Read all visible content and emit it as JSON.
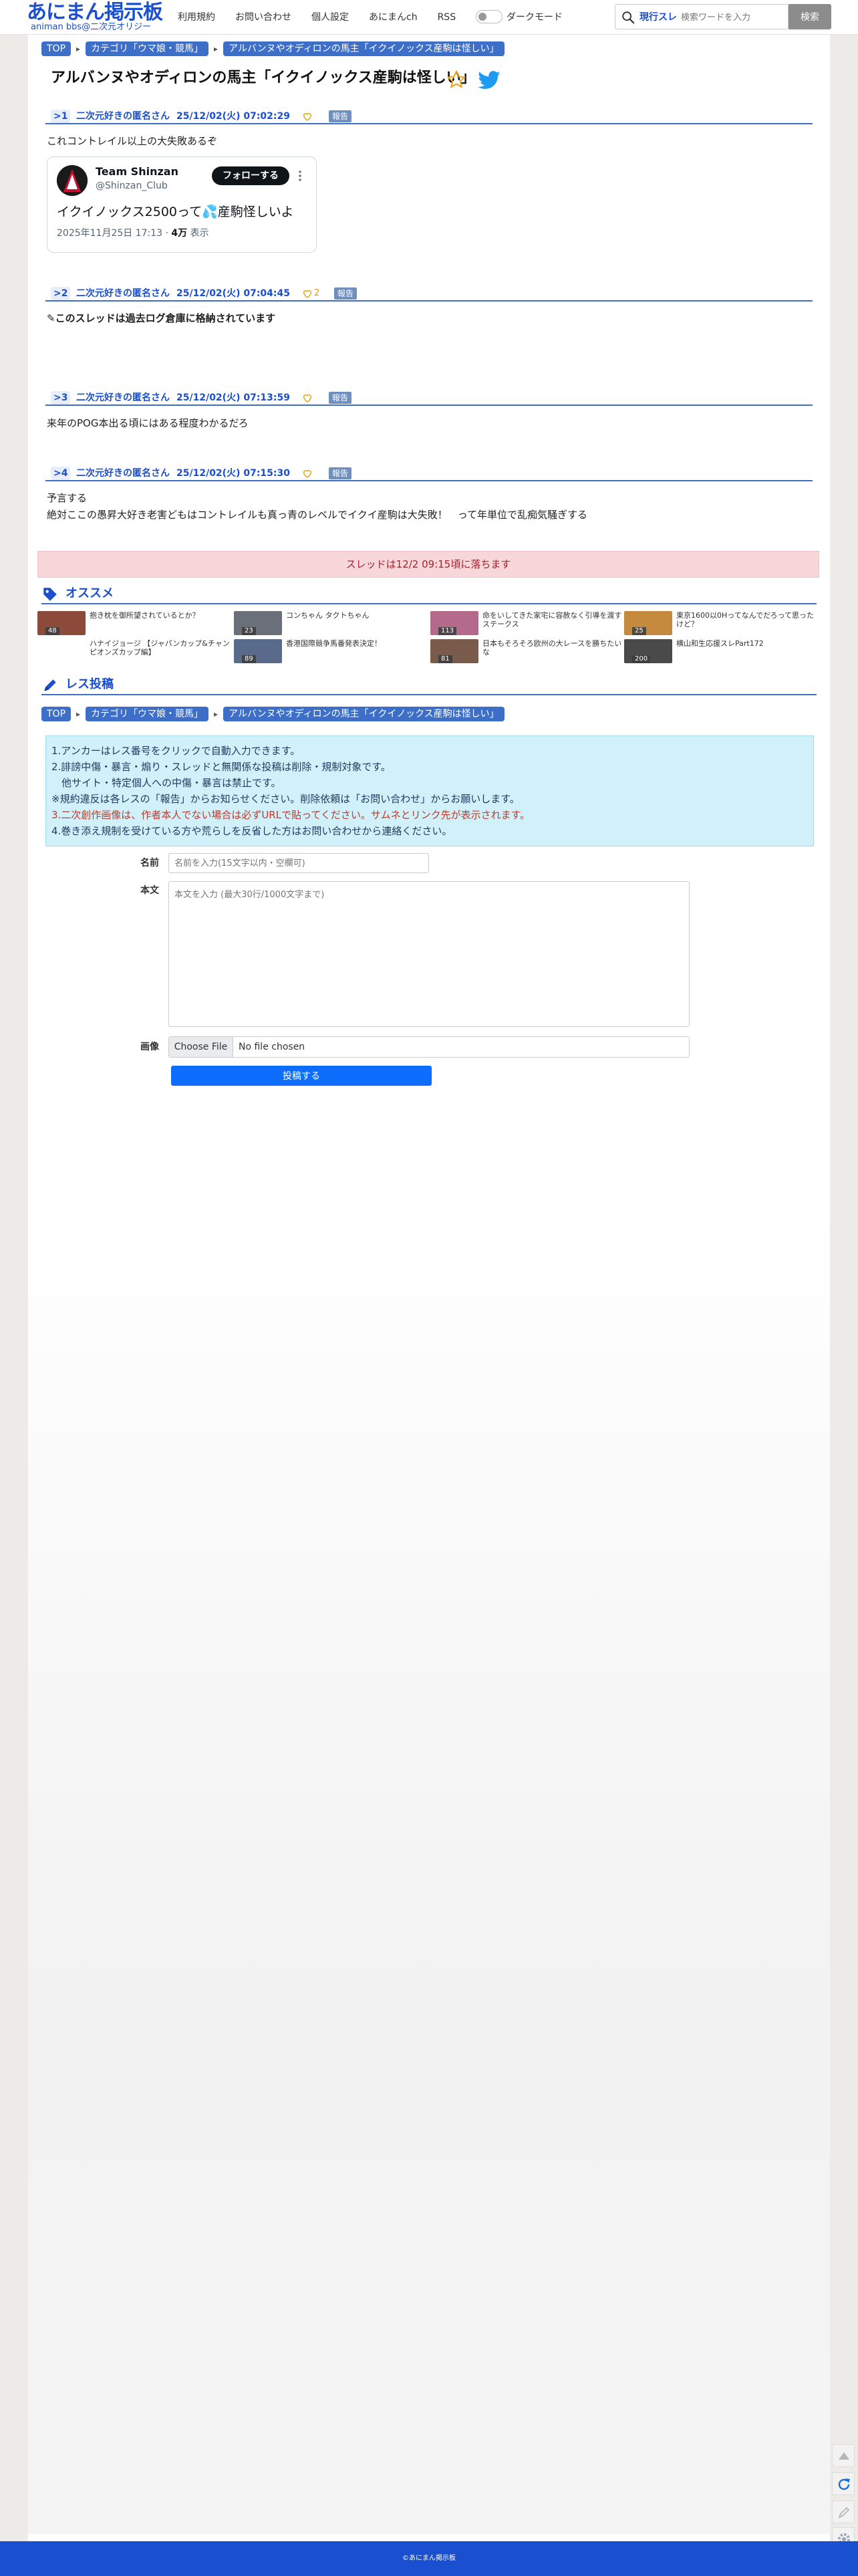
{
  "header": {
    "logo": "あにまん掲示板",
    "logo_sub": "animan bbs@二次元オリジー",
    "nav": [
      "利用規約",
      "お問い合わせ",
      "個人設定",
      "あにまんch",
      "RSS"
    ],
    "dark_mode_label": "ダークモード",
    "search_scope": "現行スレ",
    "search_placeholder": "検索ワードを入力",
    "search_button": "検索"
  },
  "breadcrumb": [
    "TOP",
    "カテゴリ「ウマ娘・競馬」",
    "アルバンヌやオディロンの馬主「イクイノックス産駒は怪しい」"
  ],
  "thread": {
    "title": "アルバンヌやオディロンの馬主「イクイノックス産駒は怪しい」"
  },
  "posts": [
    {
      "no": ">1",
      "name": "二次元好きの匿名さん",
      "date": "25/12/02(火) 07:02:29",
      "likes": "",
      "report": "報告",
      "body": [
        "これコントレイル以上の大失敗あるぞ"
      ]
    },
    {
      "no": ">2",
      "name": "二次元好きの匿名さん",
      "date": "25/12/02(火) 07:04:45",
      "likes": "2",
      "report": "報告",
      "body": [
        "✎このスレッドは過去ログ倉庫に格納されています"
      ]
    },
    {
      "no": ">3",
      "name": "二次元好きの匿名さん",
      "date": "25/12/02(火) 07:13:59",
      "likes": "",
      "report": "報告",
      "body": [
        "来年のPOG本出る頃にはある程度わかるだろ"
      ]
    },
    {
      "no": ">4",
      "name": "二次元好きの匿名さん",
      "date": "25/12/02(火) 07:15:30",
      "likes": "",
      "report": "報告",
      "body": [
        "予言する",
        "絶対ここの愚昇大好き老害どもはコントレイルも真っ青のレベルでイクイ産駒は大失敗！　って年単位で乱痴気騒ぎする"
      ]
    }
  ],
  "tweet": {
    "name": "Team Shinzan",
    "handle": "@Shinzan_Club",
    "follow": "フォローする",
    "text": "イクイノックス2500って💦産駒怪しいよ",
    "date": "2025年11月25日 17:13",
    "views_num": "4万",
    "views_label": "表示"
  },
  "archive_notice": "スレッドは12/2 09:15頃に落ちます",
  "recommend": {
    "heading": "オススメ",
    "items": [
      {
        "title": "抱き枕を御所望されているとか？",
        "count": "48",
        "color": "#8b4a3a"
      },
      {
        "title": "コンちゃん タクトちゃん",
        "count": "23",
        "color": "#6a6f7a"
      },
      {
        "title": "命をいしてきた家宅に容赦なく引導を渡すステークス",
        "count": "113",
        "color": "#b46a8a"
      },
      {
        "title": "東京1600以0Hってなんでだろって思ったけど？",
        "count": "25",
        "color": "#c58a3e"
      },
      {
        "title": "ハナイジョージ 【ジャパンカップ&チャンピオンズカップ編】",
        "count": "",
        "color": "#ffffff"
      },
      {
        "title": "香港国際競争馬番発表決定！",
        "count": "89",
        "color": "#5a6a8a"
      },
      {
        "title": "日本もそろそろ欧州の大レースを勝ちたいな",
        "count": "81",
        "color": "#7a5a4a"
      },
      {
        "title": "横山和生応援スレPart172",
        "count": "200",
        "color": "#4a4a4a"
      }
    ]
  },
  "reply_form": {
    "heading": "レス投稿",
    "rules": [
      "1.アンカーはレス番号をクリックで自動入力できます。",
      "2.誹謗中傷・暴言・煽り・スレッドと無関係な投稿は削除・規制対象です。",
      "　他サイト・特定個人への中傷・暴言は禁止です。",
      "※規約違反は各レスの「報告」からお知らせください。削除依頼は「お問い合わせ」からお願いします。",
      "3.二次創作画像は、作者本人でない場合は必ずURLで貼ってください。サムネとリンク先が表示されます。",
      "4.巻き添え規制を受けている方や荒らしを反省した方はお問い合わせから連絡ください。"
    ],
    "name_label": "名前",
    "name_placeholder": "名前を入力(15文字以内・空欄可)",
    "body_label": "本文",
    "body_placeholder": "本文を入力 (最大30行/1000文字まで)",
    "image_label": "画像",
    "file_button": "Choose File",
    "file_status": "No file chosen",
    "submit": "投稿する"
  },
  "footer": "©あにまん掲示板",
  "colors": {
    "brand": "#1a4fcf",
    "accent": "#3d6fc9",
    "notice_bg": "#f8d7da",
    "rules_bg": "#d0f1fa"
  }
}
